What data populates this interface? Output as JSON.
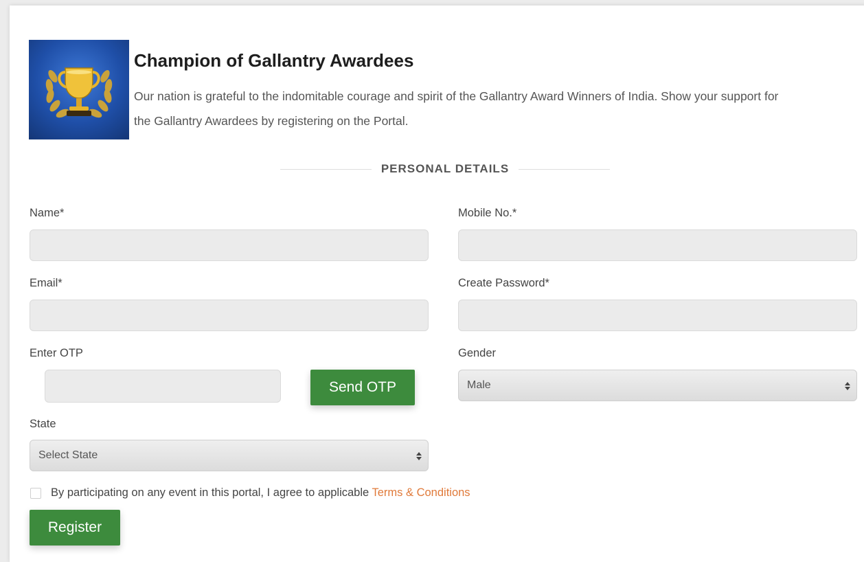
{
  "header": {
    "title": "Champion of Gallantry Awardees",
    "description": "Our nation is grateful to the indomitable courage and spirit of the Gallantry Award Winners of India. Show your support for the Gallantry Awardees by registering on the Portal.",
    "logo_icon": "trophy-laurel-icon"
  },
  "section": {
    "title": "PERSONAL DETAILS"
  },
  "form": {
    "name_label": "Name*",
    "name_value": "",
    "mobile_label": "Mobile No.*",
    "mobile_value": "",
    "email_label": "Email*",
    "email_value": "",
    "password_label": "Create Password*",
    "password_value": "",
    "otp_label": "Enter OTP",
    "otp_value": "",
    "send_otp_label": "Send OTP",
    "gender_label": "Gender",
    "gender_selected": "Male",
    "state_label": "State",
    "state_selected": "Select State",
    "agree_text": "By participating on any event in this portal, I agree to applicable",
    "terms_link": "Terms & Conditions",
    "register_label": "Register"
  },
  "colors": {
    "accent_green": "#3d8b3d",
    "link_orange": "#e07a3a",
    "logo_blue": "#1f4fa8"
  }
}
